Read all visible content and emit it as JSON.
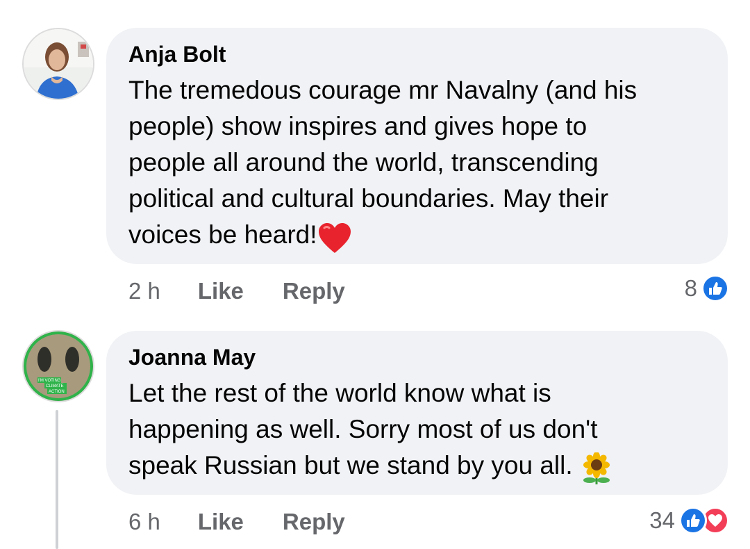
{
  "comments": [
    {
      "author": "Anja Bolt",
      "text": "The tremedous courage mr Navalny (and his\npeople) show inspires and gives hope to\npeople all around the world, transcending\npolitical and cultural boundaries. May their\nvoices be heard!",
      "time": "2 h",
      "like_label": "Like",
      "reply_label": "Reply",
      "reaction_count": "8",
      "reactions": [
        "like-icon"
      ],
      "trailing_emoji": "red-heart-emoji"
    },
    {
      "author": "Joanna May",
      "text": "Let the rest of the world know what is\nhappening as well. Sorry most of us don't\nspeak Russian but we stand by you all. ",
      "time": "6 h",
      "like_label": "Like",
      "reply_label": "Reply",
      "reaction_count": "34",
      "reactions": [
        "like-icon",
        "love-icon"
      ],
      "trailing_emoji": "sunflower-emoji",
      "avatar_overlay": [
        "I'M VOTING",
        "CLIMATE",
        "ACTION"
      ]
    }
  ],
  "colors": {
    "bubble": "#f0f2f5",
    "text": "#050505",
    "meta": "#65676b",
    "like_blue": "#1b74e4",
    "love_red": "#f33e58",
    "frame_green": "#2fb34a"
  }
}
